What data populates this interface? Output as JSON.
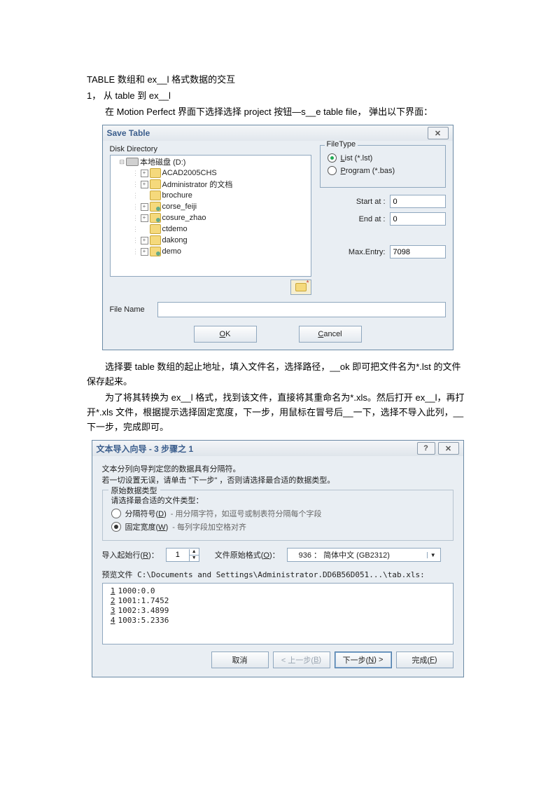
{
  "doc": {
    "title": "TABLE 数组和 ex__l 格式数据的交互",
    "sec1": "1，   从 table  到 ex__l",
    "p1": "在 Motion Perfect  界面下选择选择 project  按钮—s__e table file， 弹出以下界面：",
    "p2": "选择要 table  数组的起止地址，填入文件名，选择路径，__ok 即可把文件名为*.lst  的文件保存起来。",
    "p3": "为了将其转换为 ex__l 格式，找到该文件，直接将其重命名为*.xls。然后打开 ex__l，再打开*.xls  文件，根据提示选择固定宽度，下一步，用鼠标在冒号后__一下，选择不导入此列，__下一步，完成即可。"
  },
  "dialog1": {
    "title": "Save Table",
    "diskLabel": "Disk Directory",
    "tree": [
      {
        "level": 1,
        "expand": "-",
        "icon": "drive",
        "label": "本地磁盘 (D:)"
      },
      {
        "level": 2,
        "expand": "+",
        "icon": "folder",
        "label": "ACAD2005CHS"
      },
      {
        "level": 2,
        "expand": "+",
        "icon": "folder",
        "label": "Administrator 的文档"
      },
      {
        "level": 2,
        "expand": "",
        "icon": "folder",
        "label": "brochure"
      },
      {
        "level": 2,
        "expand": "+",
        "icon": "folder-g",
        "label": "corse_feiji"
      },
      {
        "level": 2,
        "expand": "+",
        "icon": "folder-g",
        "label": "cosure_zhao"
      },
      {
        "level": 2,
        "expand": "",
        "icon": "folder",
        "label": "ctdemo"
      },
      {
        "level": 2,
        "expand": "+",
        "icon": "folder",
        "label": "dakong"
      },
      {
        "level": 2,
        "expand": "+",
        "icon": "folder-g",
        "label": "demo"
      }
    ],
    "filetypeLegend": "FileType",
    "radioList": "List (*.lst)",
    "radioListChecked": true,
    "radioProgram": "Program (*.bas)",
    "startAtLabel": "Start at :",
    "startAtValue": "0",
    "endAtLabel": "End at :",
    "endAtValue": "0",
    "maxEntryLabel": "Max.Entry:",
    "maxEntryValue": "7098",
    "fileNameLabel": "File Name",
    "okLabel": "OK",
    "cancelLabel": "Cancel"
  },
  "dialog2": {
    "title": "文本导入向导 - 3 步骤之 1",
    "line1": "文本分列向导判定您的数据具有分隔符。",
    "line2": "若一切设置无误，请单击 \"下一步\" ，否则请选择最合适的数据类型。",
    "groupLegend": "原始数据类型",
    "groupSub": "请选择最合适的文件类型：",
    "opt1Label": "分隔符号(D)",
    "opt1Desc": "- 用分隔字符，如逗号或制表符分隔每个字段",
    "opt2Label": "固定宽度(W)",
    "opt2Desc": "- 每列字段加空格对齐",
    "opt2Checked": true,
    "startRowLabel": "导入起始行(R)：",
    "startRowValue": "1",
    "originLabel": "文件原始格式(O)：",
    "originValue": "936 ： 简体中文 (GB2312)",
    "previewLabel": "预览文件 C:\\Documents and Settings\\Administrator.DD6B56D051...\\tab.xls:",
    "previewLines": [
      "1000:0.0",
      "1001:1.7452",
      "1002:3.4899",
      "1003:5.2336"
    ],
    "btnCancel": "取消",
    "btnBack": "< 上一步(B)",
    "btnNext": "下一步(N) >",
    "btnFinish": "完成(F)"
  }
}
